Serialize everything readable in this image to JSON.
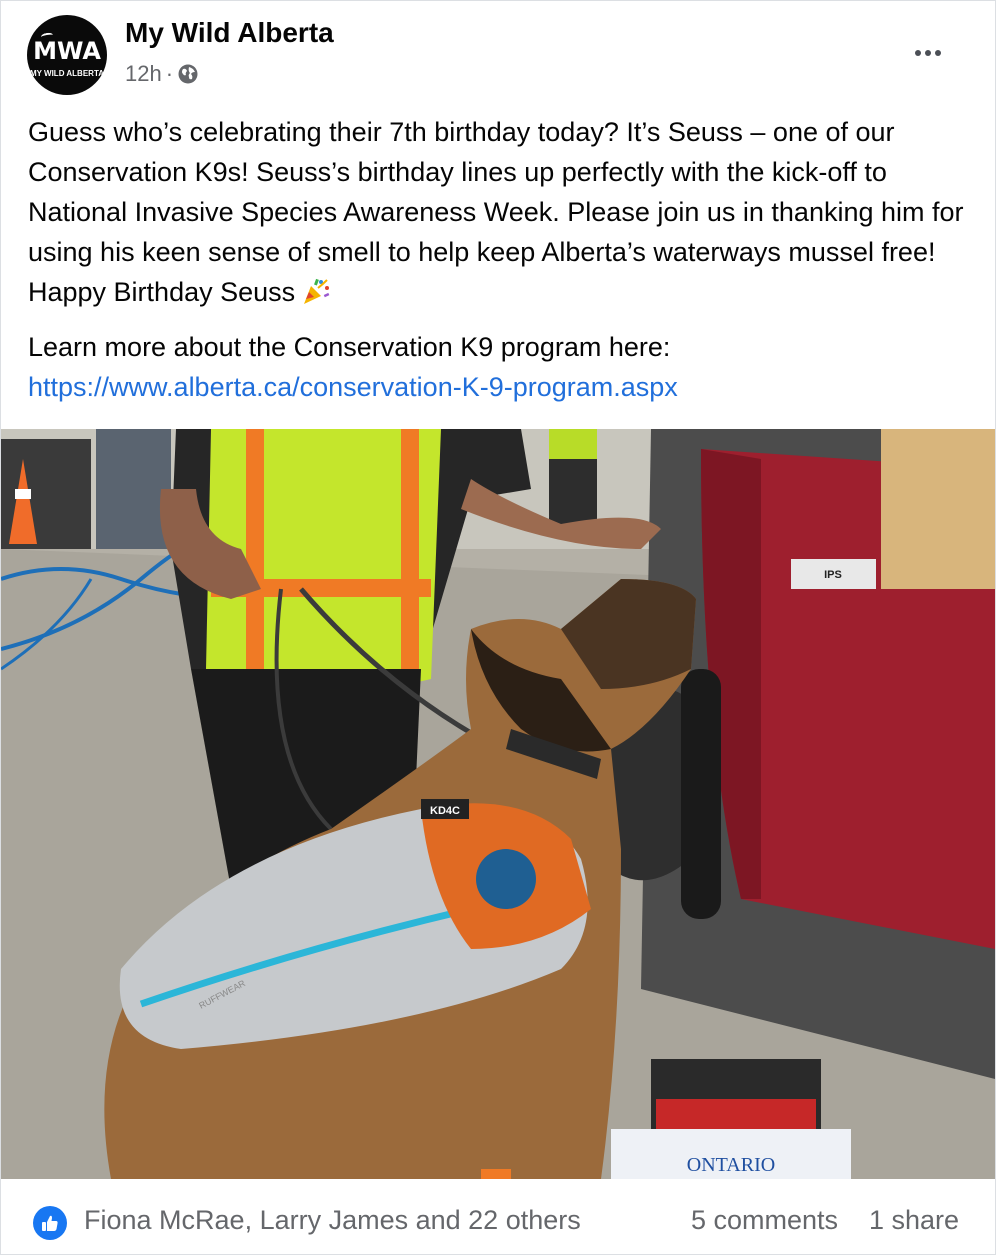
{
  "post": {
    "page_name": "My Wild Alberta",
    "time": "12h",
    "separator": "·",
    "privacy_icon": "globe-icon",
    "more_icon": "more-horizontal-icon",
    "avatar": {
      "main": "MWA",
      "sub": "MY WILD ALBERTA"
    },
    "caption": "Guess who’s celebrating their 7th birthday today? It’s Seuss – one of our Conservation K9s! Seuss’s birthday lines up perfectly with the kick-off to National Invasive Species Awareness Week. Please join us in thanking him for using his keen sense of smell to help keep Alberta’s waterways mussel free! Happy Birthday Seuss",
    "caption_emoji": "party-popper-icon",
    "learn_more": "Learn more about the Conservation K9 program here:",
    "link": "https://www.alberta.ca/conservation-K-9-program.aspx"
  },
  "photo": {
    "alt_icon": "photo-image",
    "vest_patch": "IPS",
    "plate_text": "ONTARIO",
    "harness_tag": "KD4C",
    "coat_brand": "RUFFWEAR"
  },
  "footer": {
    "like_icon": "thumbs-up-icon",
    "reactors": "Fiona McRae, Larry James and 22 others",
    "comments": "5 comments",
    "shares": "1 share"
  },
  "colors": {
    "link": "#216fdb",
    "like_badge": "#1877f2",
    "secondary_text": "#65676b"
  }
}
